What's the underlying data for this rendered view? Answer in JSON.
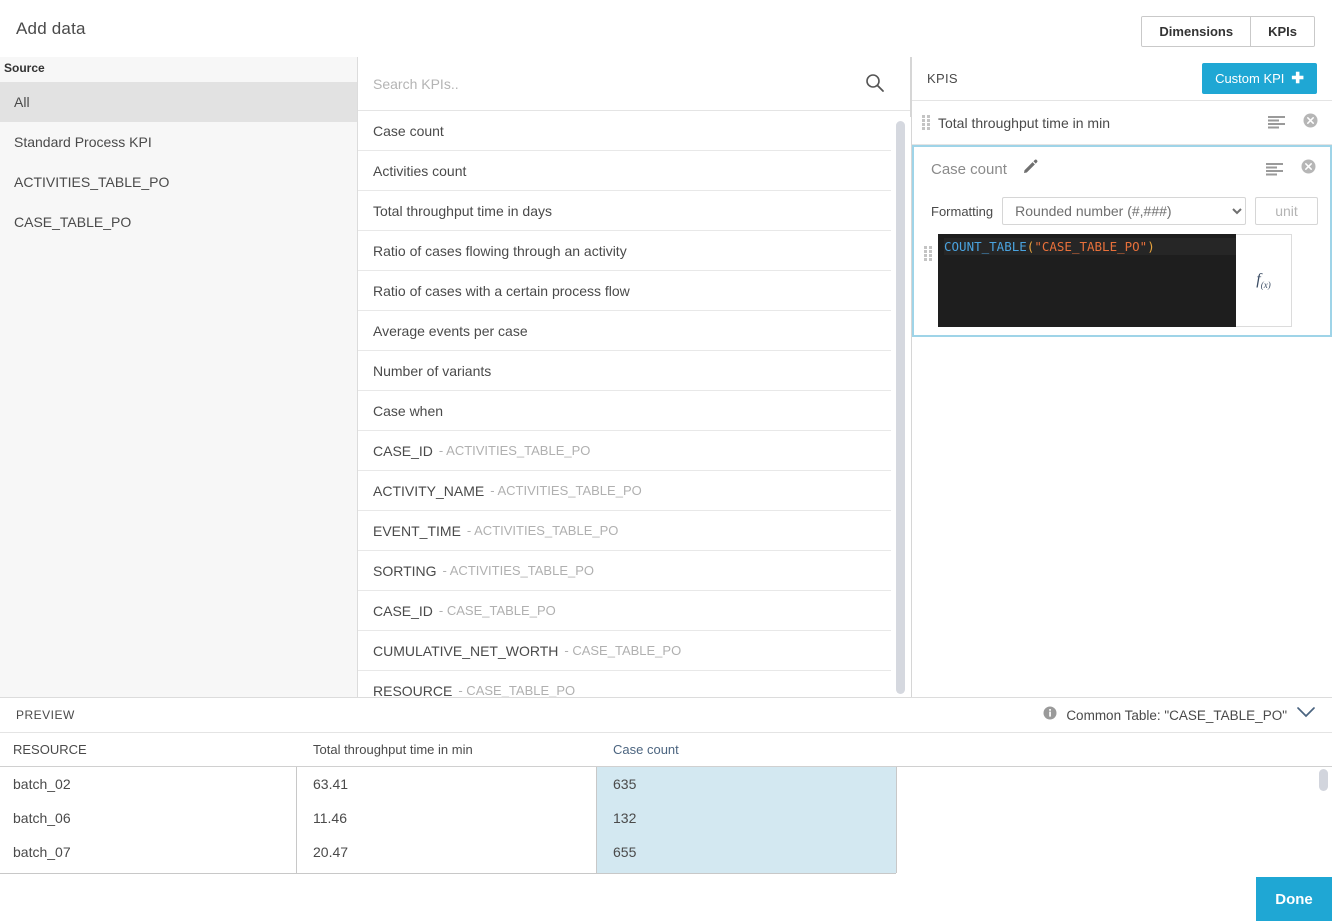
{
  "header": {
    "title": "Add data",
    "tabs": [
      {
        "label": "Dimensions",
        "name": "dimensions"
      },
      {
        "label": "KPIs",
        "name": "kpis"
      }
    ]
  },
  "source": {
    "heading": "Source",
    "items": [
      {
        "label": "All",
        "selected": true
      },
      {
        "label": "Standard Process KPI",
        "selected": false
      },
      {
        "label": "ACTIVITIES_TABLE_PO",
        "selected": false
      },
      {
        "label": "CASE_TABLE_PO",
        "selected": false
      }
    ]
  },
  "search": {
    "placeholder": "Search KPIs..",
    "value": "",
    "icon": "search-icon"
  },
  "kpi_list": [
    {
      "label": "Case count",
      "table": ""
    },
    {
      "label": "Activities count",
      "table": ""
    },
    {
      "label": "Total throughput time in days",
      "table": ""
    },
    {
      "label": "Ratio of cases flowing through an activity",
      "table": ""
    },
    {
      "label": "Ratio of cases with a certain process flow",
      "table": ""
    },
    {
      "label": "Average events per case",
      "table": ""
    },
    {
      "label": "Number of variants",
      "table": ""
    },
    {
      "label": "Case when",
      "table": ""
    },
    {
      "label": "CASE_ID",
      "table": "- ACTIVITIES_TABLE_PO"
    },
    {
      "label": "ACTIVITY_NAME",
      "table": "- ACTIVITIES_TABLE_PO"
    },
    {
      "label": "EVENT_TIME",
      "table": "- ACTIVITIES_TABLE_PO"
    },
    {
      "label": "SORTING",
      "table": "- ACTIVITIES_TABLE_PO"
    },
    {
      "label": "CASE_ID",
      "table": "- CASE_TABLE_PO"
    },
    {
      "label": "CUMULATIVE_NET_WORTH",
      "table": "- CASE_TABLE_PO"
    },
    {
      "label": "RESOURCE",
      "table": "- CASE_TABLE_PO"
    }
  ],
  "config": {
    "heading": "KPIS",
    "custom_kpi_label": "Custom KPI",
    "custom_kpi_plus": "✚",
    "accent_color": "#1fa7d4",
    "rows": [
      {
        "title": "Total throughput time in min"
      }
    ],
    "card": {
      "title": "Case count",
      "formatting_label": "Formatting",
      "formatting_value": "Rounded number (#,###)",
      "formatting_options": [
        "Rounded number (#,###)"
      ],
      "unit_placeholder": "unit",
      "unit_value": "",
      "code": {
        "fn": "COUNT_TABLE",
        "open": "(",
        "string": "\"CASE_TABLE_PO\"",
        "close": ")"
      },
      "fx_label": "f(x)"
    }
  },
  "preview": {
    "label": "PREVIEW",
    "meta_text": "Common Table: \"CASE_TABLE_PO\"",
    "columns": [
      {
        "header": "RESOURCE",
        "accent": false
      },
      {
        "header": "Total throughput time in min",
        "accent": false
      },
      {
        "header": "Case count",
        "accent": true
      }
    ],
    "rows": [
      [
        "batch_02",
        "63.41",
        "635"
      ],
      [
        "batch_06",
        "11.46",
        "132"
      ],
      [
        "batch_07",
        "20.47",
        "655"
      ]
    ],
    "highlight_color": "#d3e8f1"
  },
  "footer": {
    "done_label": "Done"
  }
}
